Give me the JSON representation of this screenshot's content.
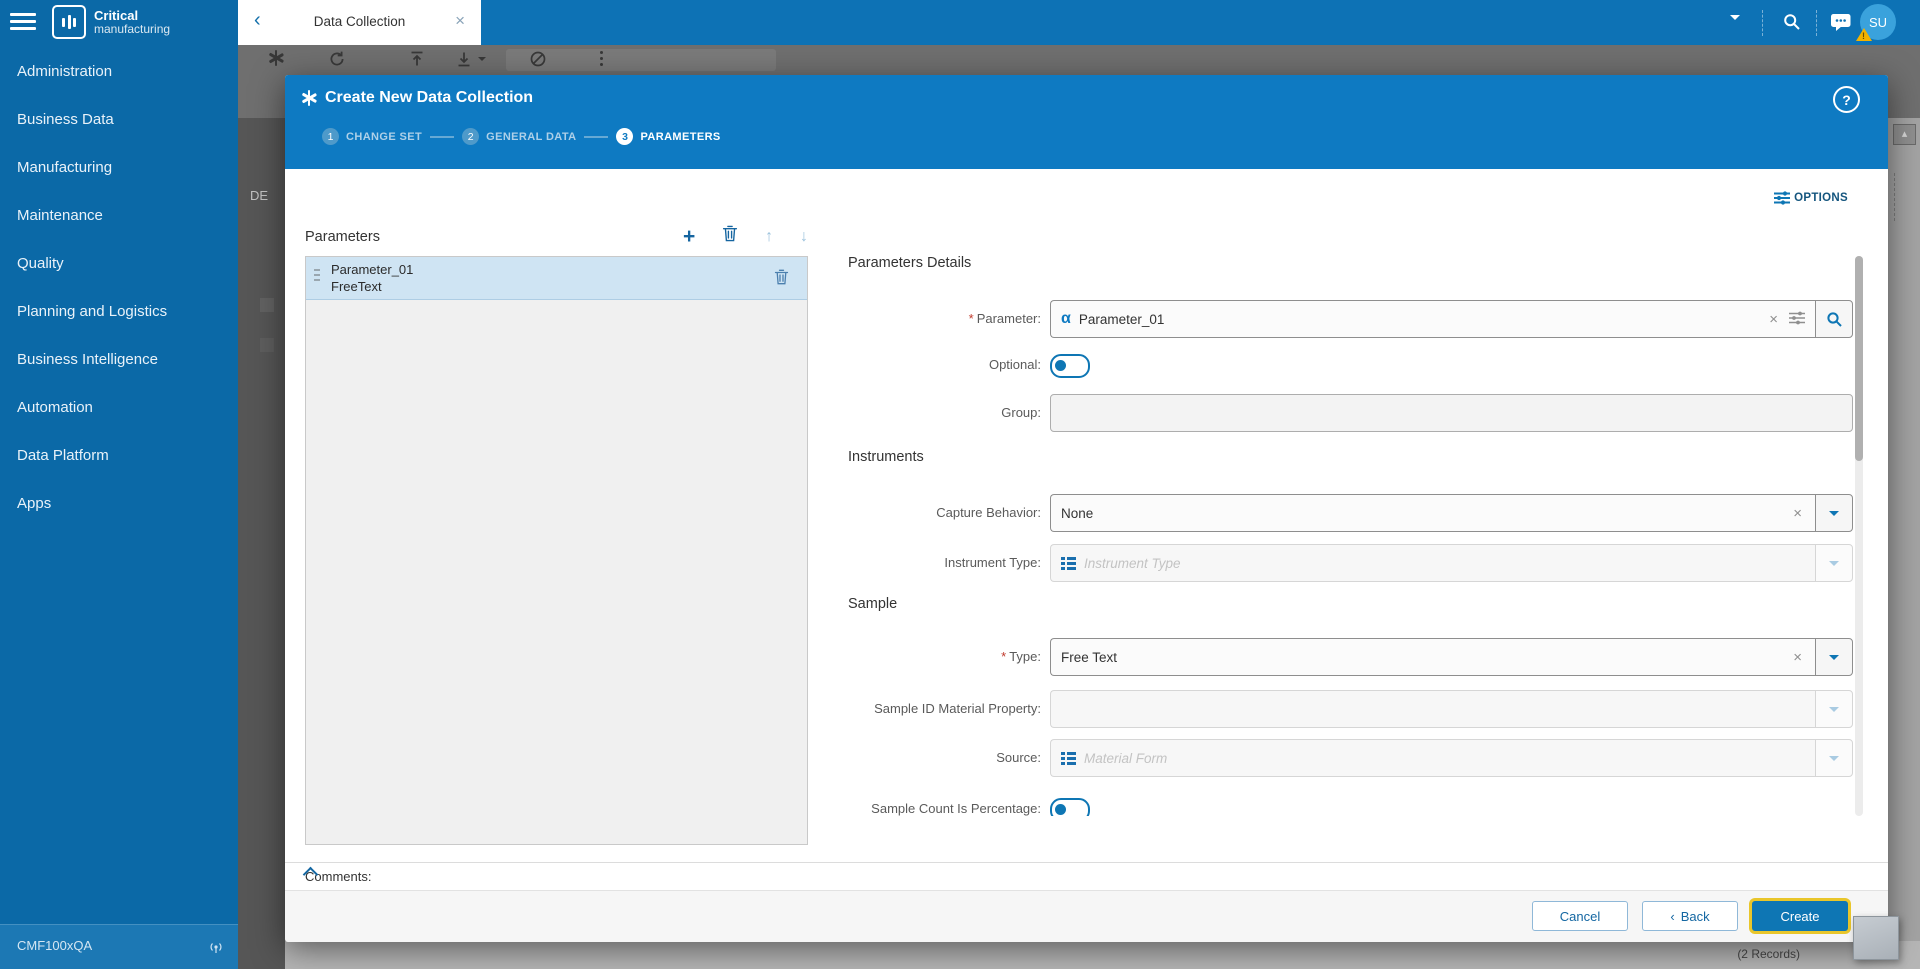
{
  "brand": {
    "line1": "Critical",
    "line2": "manufacturing"
  },
  "topbar": {
    "tab_title": "Data Collection",
    "close_glyph": "×",
    "back_glyph": "‹",
    "avatar_initials": "SU",
    "warning_glyph": "!"
  },
  "sidebar": {
    "items": [
      "Administration",
      "Business Data",
      "Manufacturing",
      "Maintenance",
      "Quality",
      "Planning and Logistics",
      "Business Intelligence",
      "Automation",
      "Data Platform",
      "Apps"
    ],
    "footer": "CMF100xQA"
  },
  "backdrop": {
    "fragment_text": "DE",
    "records": "(2 Records)"
  },
  "modal": {
    "header": {
      "title": "Create New Data Collection",
      "help_glyph": "?"
    },
    "steps": [
      {
        "num": "1",
        "label": "CHANGE SET"
      },
      {
        "num": "2",
        "label": "GENERAL DATA"
      },
      {
        "num": "3",
        "label": "PARAMETERS"
      }
    ],
    "options_label": "OPTIONS",
    "list": {
      "title": "Parameters",
      "add_glyph": "+",
      "up_glyph": "↑",
      "down_glyph": "↓",
      "item": {
        "name": "Parameter_01",
        "type": "FreeText"
      }
    },
    "details": {
      "heading": "Parameters Details",
      "sections": {
        "instruments": "Instruments",
        "sample": "Sample"
      },
      "required_mark": "*",
      "clear_glyph": "×",
      "alpha_glyph": "α",
      "rows": {
        "parameter": {
          "label": "Parameter:",
          "value": "Parameter_01"
        },
        "optional": {
          "label": "Optional:",
          "state": "off"
        },
        "group": {
          "label": "Group:",
          "value": ""
        },
        "capture": {
          "label": "Capture Behavior:",
          "value": "None"
        },
        "instrument_type": {
          "label": "Instrument Type:",
          "placeholder": "Instrument Type"
        },
        "type": {
          "label": "Type:",
          "value": "Free Text"
        },
        "sample_id": {
          "label": "Sample ID Material Property:",
          "value": ""
        },
        "source": {
          "label": "Source:",
          "placeholder": "Material Form"
        },
        "sample_count": {
          "label": "Sample Count Is Percentage:",
          "state": "off"
        }
      }
    },
    "comments": {
      "label": "Comments:"
    },
    "footer": {
      "cancel": "Cancel",
      "back": "Back",
      "back_chevron": "‹",
      "create": "Create"
    }
  },
  "colors": {
    "topbar_blue": "#0d72b5",
    "sidebar_blue": "#0b69a7",
    "modal_header_blue": "#0e7ac2",
    "accent_blue": "#1467a2",
    "selected_row": "#cfe4f3",
    "primary_button": "#0e76b4",
    "focus_ring": "#e9c62b",
    "warning_yellow": "#f3b200",
    "required_red": "#c0392b"
  }
}
